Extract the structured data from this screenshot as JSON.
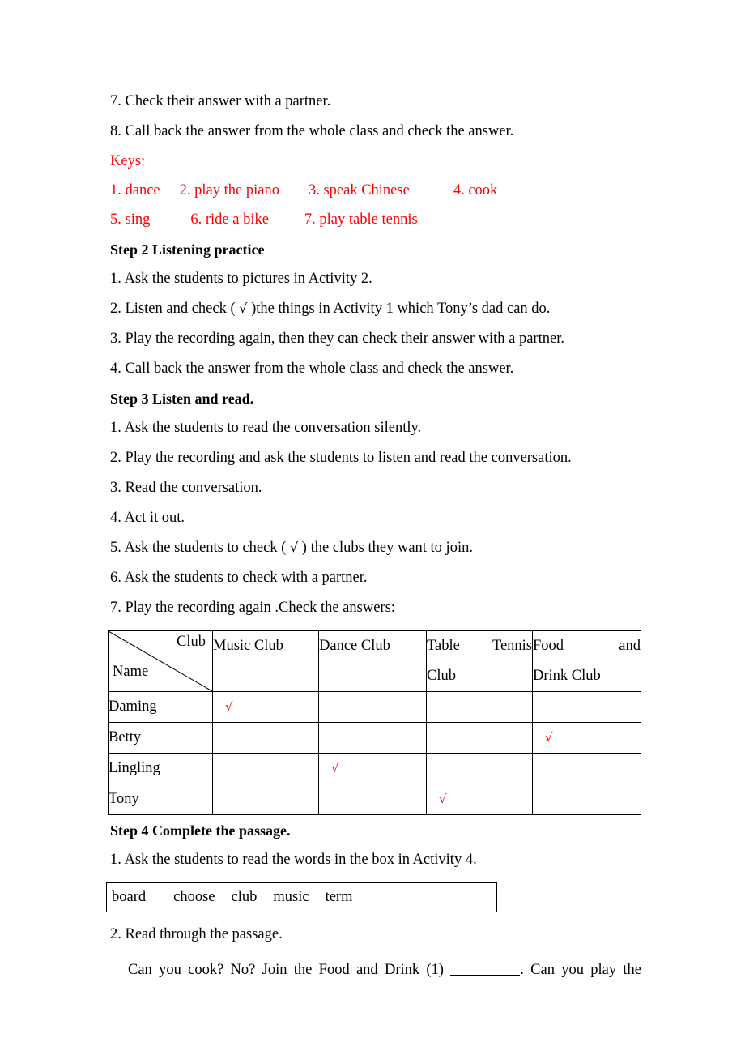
{
  "document": {
    "accent_red": "#ff0000",
    "text_color": "#000000",
    "background": "#ffffff"
  },
  "lines": {
    "item7_check": "7. Check their answer with a partner.",
    "item8_callback": "8. Call back the answer from the whole class and check the answer.",
    "keys_label": "Keys:"
  },
  "keys": {
    "row1": [
      {
        "text": "1. dance"
      },
      {
        "text": "2. play the piano"
      },
      {
        "text": "3. speak Chinese"
      },
      {
        "text": "4. cook"
      }
    ],
    "row2": [
      {
        "text": "5. sing"
      },
      {
        "text": "6. ride a bike"
      },
      {
        "text": "7. play table tennis"
      }
    ]
  },
  "step2": {
    "heading": "Step 2 Listening practice",
    "items": [
      "1. Ask the students to pictures in Activity 2.",
      "2. Listen and check ( √ )the things in Activity 1 which Tony’s dad can do.",
      "3. Play the recording again, then they can check their answer with a partner.",
      "4. Call back the answer from the whole class and check the answer."
    ],
    "item2_prefix": "2. Listen and check ( ",
    "item2_check": "√",
    "item2_suffix": " )the things in Activity 1 which Tony’s dad can do."
  },
  "step3": {
    "heading": "Step 3 Listen and read.",
    "items": [
      "1. Ask the students to read the conversation silently.",
      "2. Play the recording and ask the students to listen and read the conversation.",
      "3. Read the conversation.",
      "4. Act it out.",
      "6. Ask the students to check with a partner.",
      "7. Play the recording again .Check the answers:"
    ],
    "item5_prefix": "5. Ask the students to check ( ",
    "item5_check": "√",
    "item5_suffix": " ) the clubs they want to join."
  },
  "table": {
    "corner": {
      "col_label": "Club",
      "row_label": "Name"
    },
    "columns": [
      "Music Club",
      "Dance Club",
      "Table Tennis Club",
      "Food and Drink Club"
    ],
    "column_lines": [
      {
        "line1": "Music Club",
        "line2": "",
        "justify1": false
      },
      {
        "line1": "Dance Club",
        "line2": "",
        "justify1": false
      },
      {
        "line1": "Table Tennis",
        "line2": "Club",
        "justify1": true
      },
      {
        "line1": "Food and",
        "line2": "Drink Club",
        "justify1": true
      }
    ],
    "check_symbol": "√",
    "rows": [
      {
        "name": "Daming",
        "checks": [
          true,
          false,
          false,
          false
        ]
      },
      {
        "name": "Betty",
        "checks": [
          false,
          false,
          false,
          true
        ]
      },
      {
        "name": "Lingling",
        "checks": [
          false,
          true,
          false,
          false
        ]
      },
      {
        "name": "Tony",
        "checks": [
          false,
          false,
          true,
          false
        ]
      }
    ]
  },
  "step4": {
    "heading": "Step 4 Complete the passage.",
    "item1": "1. Ask the students to read the words in the box in Activity 4.",
    "item2": "2. Read through the passage.",
    "word_bank": [
      "board",
      "choose",
      "club",
      "music",
      "term"
    ],
    "passage_part1": "Can you cook? No? Join the Food and Drink (1)",
    "passage_part2": ". Can you play the"
  }
}
